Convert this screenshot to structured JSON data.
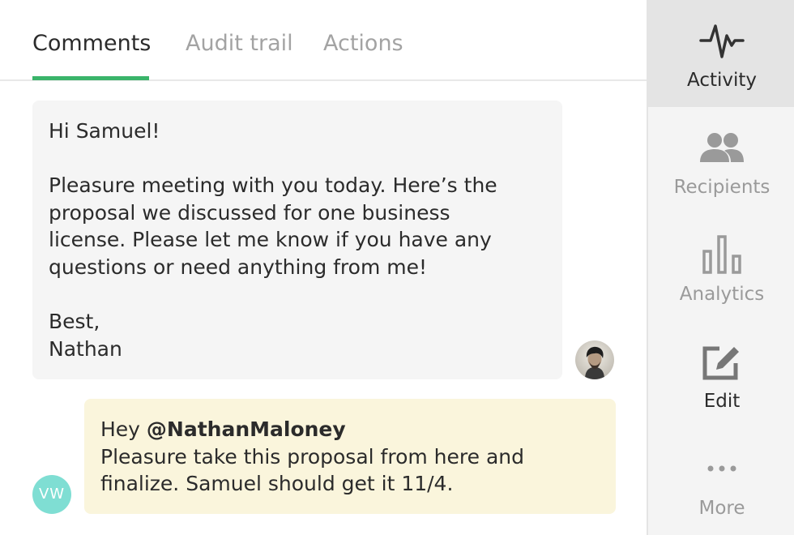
{
  "tabs": [
    {
      "label": "Comments",
      "active": true
    },
    {
      "label": "Audit trail",
      "active": false
    },
    {
      "label": "Actions",
      "active": false
    }
  ],
  "messages": [
    {
      "lines": [
        "Hi Samuel!",
        "",
        "Pleasure meeting with you today. Here’s the",
        "proposal we discussed for one business",
        "license. Please let me know if you have any",
        "questions or need anything from me!",
        "",
        "Best,",
        "Nathan"
      ],
      "background": "#f5f5f5"
    },
    {
      "greeting": "Hey ",
      "mention": "@NathanMaloney",
      "lines": [
        "Pleasure take this proposal from here and",
        "finalize. Samuel should get it 11/4."
      ],
      "background": "#faf5dc",
      "author_initials": "VW"
    }
  ],
  "sidebar": {
    "items": [
      {
        "label": "Activity",
        "icon": "activity-pulse-icon",
        "active": true
      },
      {
        "label": "Recipients",
        "icon": "people-icon",
        "active": false
      },
      {
        "label": "Analytics",
        "icon": "bar-chart-icon",
        "active": false
      },
      {
        "label": "Edit",
        "icon": "edit-pencil-icon",
        "active": false
      },
      {
        "label": "More",
        "icon": "more-dots-icon",
        "active": false
      }
    ]
  },
  "colors": {
    "accent": "#3ab46a",
    "initials_avatar": "#7fded3",
    "note_background": "#faf5dc"
  }
}
